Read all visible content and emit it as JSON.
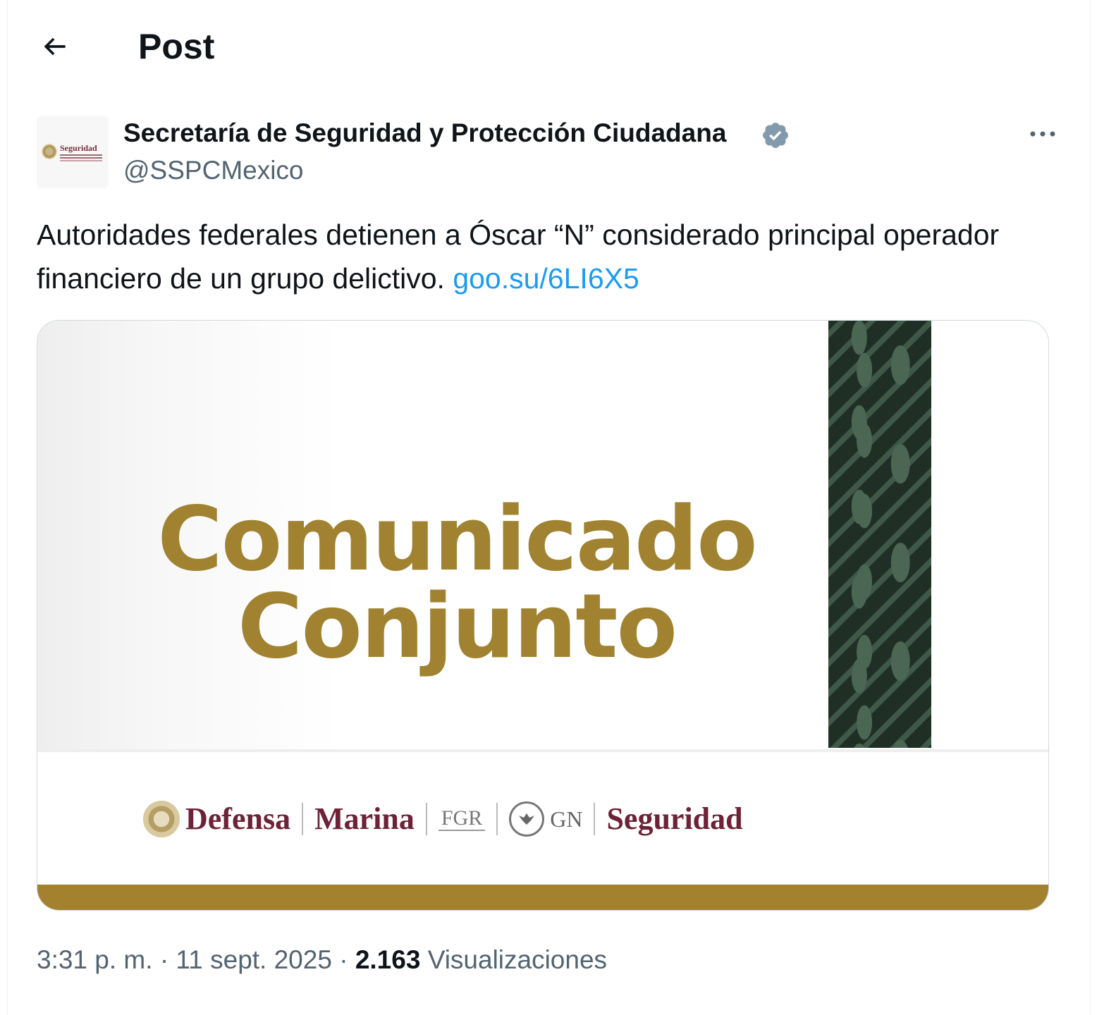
{
  "header": {
    "title": "Post"
  },
  "post": {
    "author_name": "Secretaría de Seguridad y Protección Ciudadana",
    "handle": "@SSPCMexico",
    "avatar_text": "Seguridad",
    "text": "Autoridades federales detienen a Óscar “N” considerado principal operador financiero de un grupo delictivo. ",
    "link": "goo.su/6LI6X5",
    "time": "3:31 p. m.",
    "date": "11 sept. 2025",
    "separator": "·",
    "views_count": "2.163",
    "views_label": "Visualizaciones"
  },
  "media": {
    "headline_line1": "Comunicado",
    "headline_line2": "Conjunto",
    "logos": [
      "Defensa",
      "Marina",
      "FGR",
      "GN",
      "Seguridad"
    ]
  },
  "colors": {
    "link": "#1d9bf0",
    "verified": "#829aab",
    "gold": "#a3812e",
    "wine": "#6d2237",
    "green_stripe": "#2b3f31"
  },
  "icons": [
    "back-arrow-icon",
    "verified-badge-icon",
    "more-options-icon"
  ]
}
